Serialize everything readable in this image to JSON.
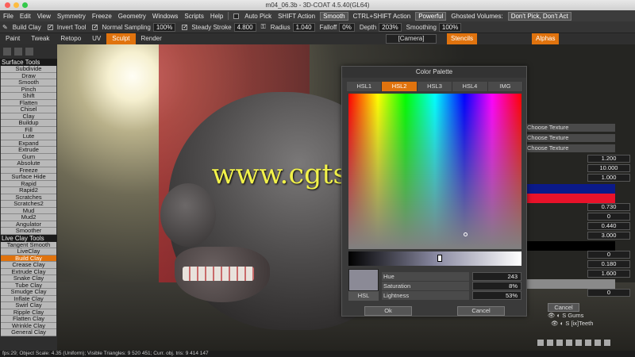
{
  "window": {
    "title": "m04_06.3b - 3D-COAT 4.5.40(GL64)"
  },
  "menu": {
    "items": [
      "File",
      "Edit",
      "View",
      "Symmetry",
      "Freeze",
      "Geometry",
      "Windows",
      "Scripts",
      "Help"
    ],
    "auto_pick": "Auto Pick",
    "shift_action_label": "SHIFT Action",
    "shift_action_value": "Smooth",
    "ctrl_shift_label": "CTRL+SHIFT Action",
    "ctrl_shift_value": "Powerful",
    "ghosted_label": "Ghosted Volumes:",
    "ghosted_value": "Don't Pick, Don't Act"
  },
  "tool_options": {
    "tool": "Build Clay",
    "invert": "Invert Tool",
    "normal_sampling_label": "Normal Sampling",
    "normal_sampling_value": "100%",
    "steady_label": "Steady Stroke",
    "steady_value": "4.800",
    "radius_label": "Radius",
    "radius_value": "1.040",
    "falloff_label": "Falloff",
    "falloff_value": "0%",
    "depth_label": "Depth",
    "depth_value": "203%",
    "smoothing_label": "Smoothing",
    "smoothing_value": "100%"
  },
  "rooms": {
    "items": [
      "Paint",
      "Tweak",
      "Retopo",
      "UV",
      "Sculpt",
      "Render"
    ],
    "active": "Sculpt",
    "camera": "[Camera]",
    "stencils": "Stencils",
    "alphas": "Alphas"
  },
  "left_tools": {
    "surface_header": "Surface Tools",
    "surface": [
      "Subdivide",
      "Draw",
      "Smooth",
      "Pinch",
      "Shift",
      "Flatten",
      "Chisel",
      "Clay",
      "Buildup",
      "Fill",
      "Lute",
      "Expand",
      "Extrude",
      "Gum",
      "Absolute",
      "Freeze",
      "Surface Hide",
      "Rapid",
      "Rapid2",
      "Scratches",
      "Scratches2",
      "Mud",
      "Mud2",
      "Angulator",
      "Smoother"
    ],
    "live_header": "Live Clay Tools",
    "live": [
      "Tangent Smooth",
      "LiveClay",
      "Build Clay",
      "Crease Clay",
      "Extrude Clay",
      "Snake Clay",
      "Tube Clay",
      "Smudge Clay",
      "Inflate Clay",
      "Swirl Clay",
      "Ripple Clay",
      "Flatten Clay",
      "Wrinkle Clay",
      "General Clay"
    ],
    "active": "Build Clay"
  },
  "watermark": "www.cgtsj.com",
  "palette": {
    "title": "Color Palette",
    "tabs": [
      "HSL1",
      "HSL2",
      "HSL3",
      "HSL4",
      "IMG"
    ],
    "active_tab": "HSL2",
    "swatch_color": "#8b8a96",
    "mode_button": "HSL",
    "hue_label": "Hue",
    "hue_value": "243",
    "saturation_label": "Saturation",
    "saturation_value": "8%",
    "lightness_label": "Lightness",
    "lightness_value": "53%",
    "ok": "Ok",
    "cancel": "Cancel"
  },
  "right_panel": {
    "choose_texture": [
      "Choose Texture",
      "Choose Texture",
      "Choose Texture"
    ],
    "values": [
      "1.200",
      "10.000",
      "1.000",
      "0.730",
      "0",
      "0.440",
      "3.000",
      "0",
      "0.180",
      "1.600",
      "0"
    ],
    "cancel": "Cancel",
    "tree": [
      "Gums",
      "[ix]Teeth"
    ]
  },
  "status": {
    "text": "fps:29;    Object Scale: 4.35 (Uniform); Visible Triangles: 9 520 451; Curr. obj. tris: 9 414 147"
  },
  "colors": {
    "accent": "#e0730e"
  }
}
